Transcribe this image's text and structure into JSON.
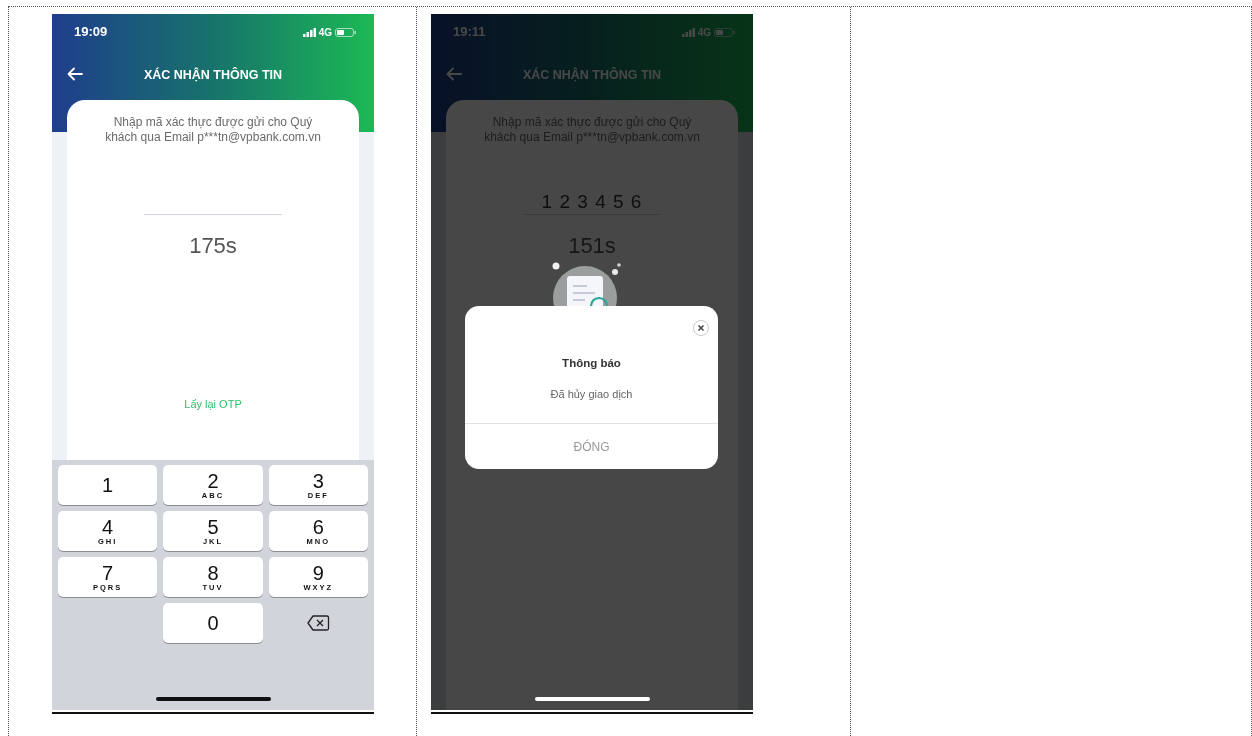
{
  "screens": [
    {
      "status_bar": {
        "time": "19:09",
        "network": "4G"
      },
      "header": {
        "title": "XÁC NHẬN THÔNG TIN"
      },
      "instruction": "Nhập mã xác thực được gửi cho Quý khách qua Email p***tn@vpbank.com.vn",
      "timer": "175s",
      "resend_link": "Lấy lại OTP",
      "keypad": [
        {
          "kind": "digit",
          "digit": "1"
        },
        {
          "kind": "digit",
          "digit": "2",
          "letters": "ABC"
        },
        {
          "kind": "digit",
          "digit": "3",
          "letters": "DEF"
        },
        {
          "kind": "digit",
          "digit": "4",
          "letters": "GHI"
        },
        {
          "kind": "digit",
          "digit": "5",
          "letters": "JKL"
        },
        {
          "kind": "digit",
          "digit": "6",
          "letters": "MNO"
        },
        {
          "kind": "digit",
          "digit": "7",
          "letters": "PQRS"
        },
        {
          "kind": "digit",
          "digit": "8",
          "letters": "TUV"
        },
        {
          "kind": "digit",
          "digit": "9",
          "letters": "WXYZ"
        },
        {
          "kind": "blank"
        },
        {
          "kind": "digit",
          "digit": "0"
        },
        {
          "kind": "backspace"
        }
      ]
    },
    {
      "status_bar": {
        "time": "19:11",
        "network": "4G"
      },
      "header": {
        "title": "XÁC NHẬN THÔNG TIN"
      },
      "instruction": "Nhập mã xác thực được gửi cho Quý khách qua Email p***tn@vpbank.com.vn",
      "otp_value": "1 2 3 4 5 6",
      "timer": "151s",
      "dialog": {
        "title": "Thông báo",
        "message": "Đã hủy giao dịch",
        "button": "ĐÓNG"
      }
    }
  ]
}
